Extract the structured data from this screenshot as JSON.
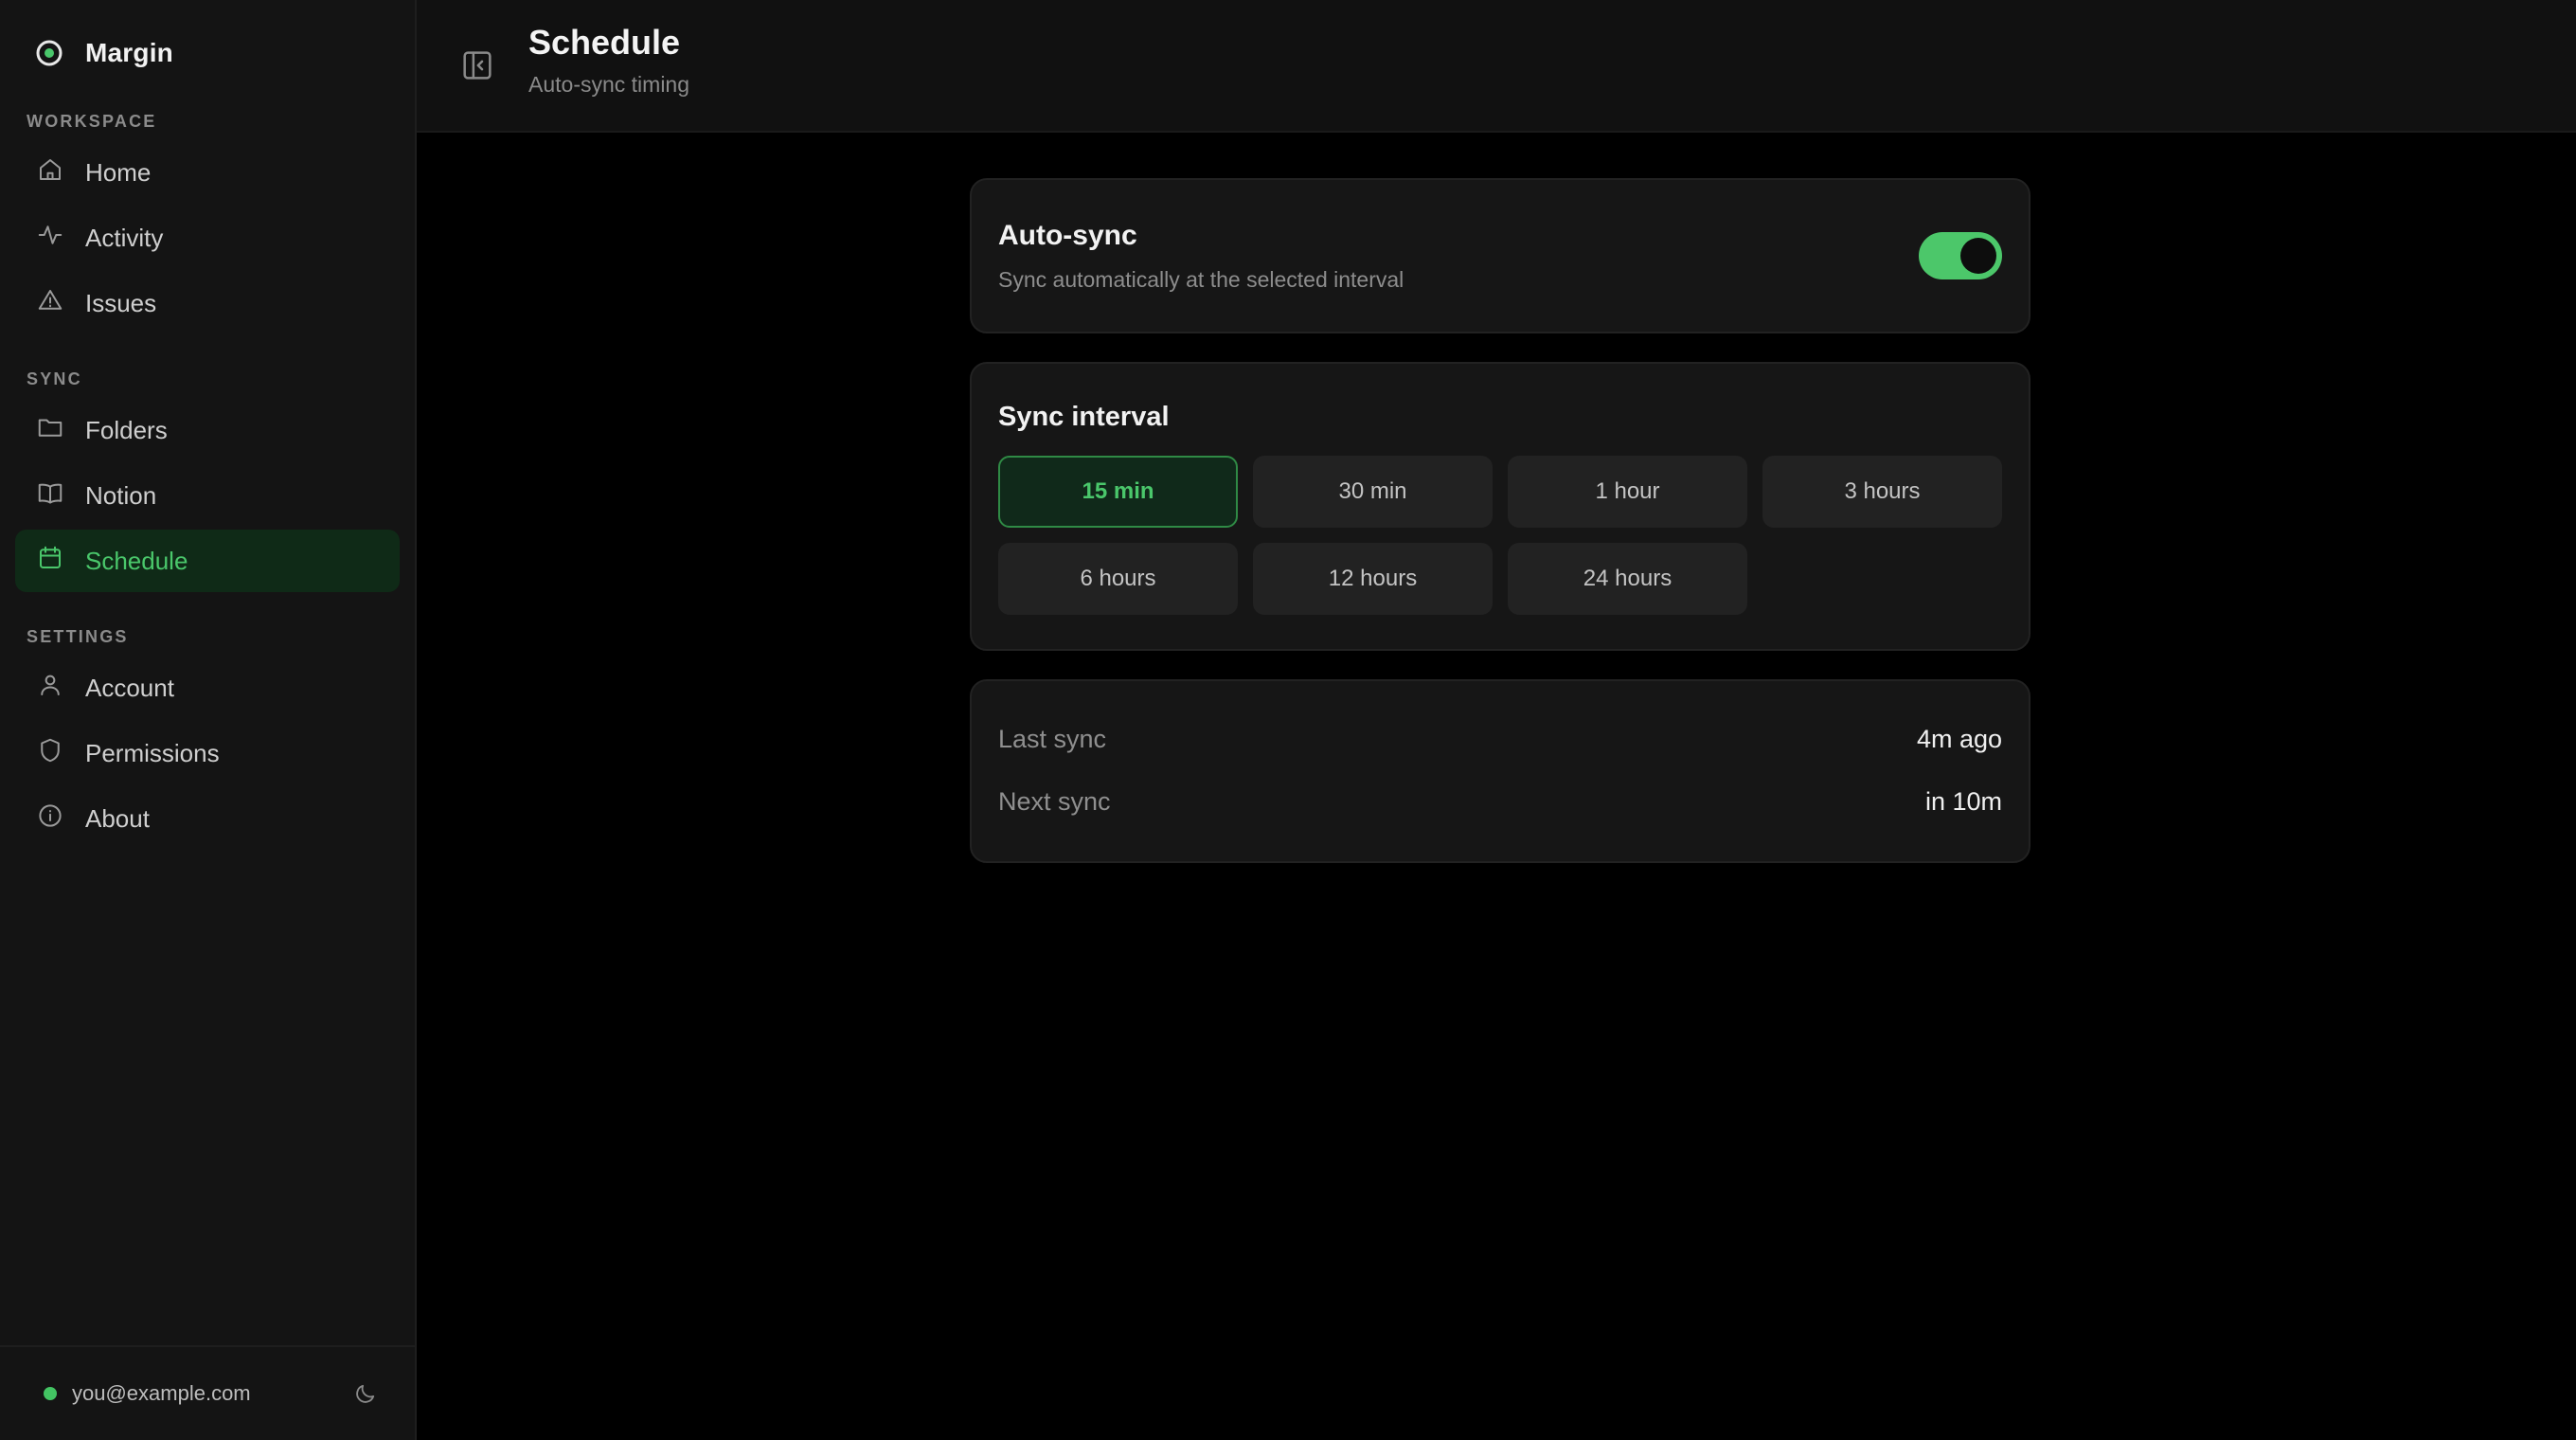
{
  "app": {
    "name": "Margin"
  },
  "sidebar": {
    "sections": [
      {
        "label": "WORKSPACE",
        "items": [
          {
            "label": "Home",
            "icon": "home-icon"
          },
          {
            "label": "Activity",
            "icon": "activity-icon"
          },
          {
            "label": "Issues",
            "icon": "alert-triangle-icon"
          }
        ]
      },
      {
        "label": "SYNC",
        "items": [
          {
            "label": "Folders",
            "icon": "folder-icon"
          },
          {
            "label": "Notion",
            "icon": "book-icon"
          },
          {
            "label": "Schedule",
            "icon": "calendar-icon",
            "active": true
          }
        ]
      },
      {
        "label": "SETTINGS",
        "items": [
          {
            "label": "Account",
            "icon": "user-icon"
          },
          {
            "label": "Permissions",
            "icon": "shield-icon"
          },
          {
            "label": "About",
            "icon": "info-icon"
          }
        ]
      }
    ],
    "footer": {
      "email": "you@example.com",
      "status_color": "#43c463"
    }
  },
  "header": {
    "title": "Schedule",
    "subtitle": "Auto-sync timing"
  },
  "autosync": {
    "title": "Auto-sync",
    "description": "Sync automatically at the selected interval",
    "enabled": true
  },
  "interval": {
    "title": "Sync interval",
    "options": [
      "15 min",
      "30 min",
      "1 hour",
      "3 hours",
      "6 hours",
      "12 hours",
      "24 hours"
    ],
    "selected": "15 min"
  },
  "status": {
    "last_label": "Last sync",
    "last_value": "4m ago",
    "next_label": "Next sync",
    "next_value": "in 10m"
  },
  "colors": {
    "accent": "#4ac76b",
    "active_bg": "#0f2a17",
    "background": "#000000",
    "sidebar": "#141414"
  }
}
